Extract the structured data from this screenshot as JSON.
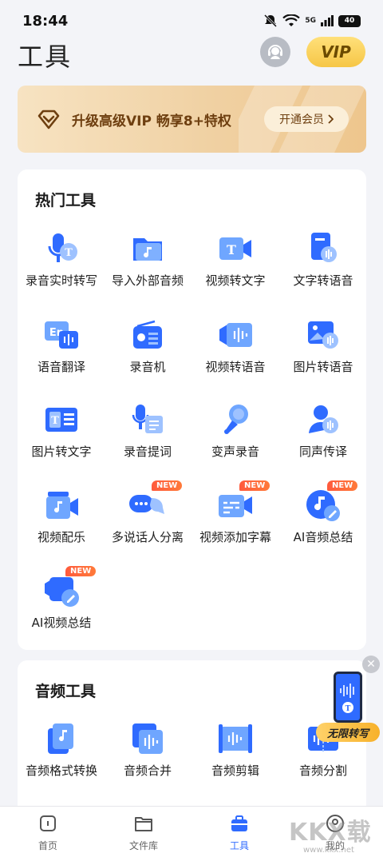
{
  "status_bar": {
    "time": "18:44",
    "signal_label": "5G",
    "battery": "40"
  },
  "header": {
    "title": "工具",
    "vip_label": "VIP"
  },
  "vip_banner": {
    "text": "升级高级VIP 畅享8+特权",
    "button_label": "开通会员"
  },
  "hot_tools": {
    "title": "热门工具",
    "items": [
      {
        "label": "录音实时转写",
        "icon": "mic-transcribe-icon"
      },
      {
        "label": "导入外部音频",
        "icon": "folder-music-icon"
      },
      {
        "label": "视频转文字",
        "icon": "video-text-icon"
      },
      {
        "label": "文字转语音",
        "icon": "doc-speech-icon"
      },
      {
        "label": "语音翻译",
        "icon": "translate-icon"
      },
      {
        "label": "录音机",
        "icon": "recorder-icon"
      },
      {
        "label": "视频转语音",
        "icon": "video-audio-icon"
      },
      {
        "label": "图片转语音",
        "icon": "image-speech-icon"
      },
      {
        "label": "图片转文字",
        "icon": "image-text-icon"
      },
      {
        "label": "录音提词",
        "icon": "teleprompter-icon"
      },
      {
        "label": "变声录音",
        "icon": "voice-changer-icon"
      },
      {
        "label": "同声传译",
        "icon": "interpretation-icon"
      },
      {
        "label": "视频配乐",
        "icon": "video-music-icon"
      },
      {
        "label": "多说话人分离",
        "icon": "speaker-separation-icon",
        "badge": "NEW"
      },
      {
        "label": "视频添加字幕",
        "icon": "video-subtitle-icon",
        "badge": "NEW"
      },
      {
        "label": "AI音频总结",
        "icon": "ai-audio-summary-icon",
        "badge": "NEW"
      },
      {
        "label": "AI视频总结",
        "icon": "ai-video-summary-icon",
        "badge": "NEW"
      }
    ]
  },
  "audio_tools": {
    "title": "音频工具",
    "items": [
      {
        "label": "音频格式转换",
        "icon": "format-convert-icon"
      },
      {
        "label": "音频合并",
        "icon": "audio-merge-icon"
      },
      {
        "label": "音频剪辑",
        "icon": "audio-cut-icon"
      },
      {
        "label": "音频分割",
        "icon": "audio-split-icon"
      }
    ]
  },
  "float_ad": {
    "label": "无限转写"
  },
  "tabbar": {
    "tabs": [
      {
        "label": "首页",
        "icon": "home-icon",
        "active": false
      },
      {
        "label": "文件库",
        "icon": "folder-icon",
        "active": false
      },
      {
        "label": "工具",
        "icon": "toolbox-icon",
        "active": true
      },
      {
        "label": "我的",
        "icon": "profile-icon",
        "active": false
      }
    ]
  },
  "watermark": {
    "text": "KKX载",
    "url": "www.kkx.net"
  },
  "colors": {
    "accent": "#2f6bff",
    "vip_gold": "#f6c646",
    "badge_red": "#ff5a3c"
  }
}
